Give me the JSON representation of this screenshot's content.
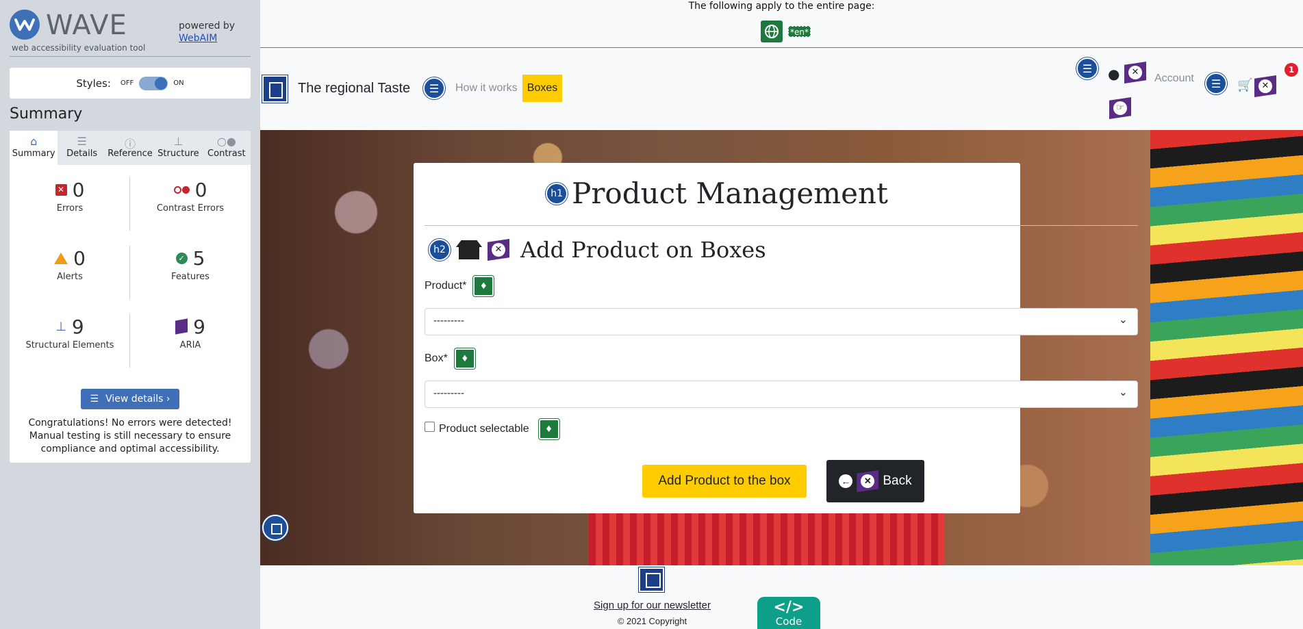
{
  "wave": {
    "title": "WAVE",
    "subtitle": "web accessibility evaluation tool",
    "powered_by": "powered by",
    "webaim_link": "WebAIM",
    "styles_label": "Styles:",
    "styles_off": "OFF",
    "styles_on": "ON",
    "summary_heading": "Summary",
    "tabs": [
      {
        "label": "Summary",
        "icon": "home-icon"
      },
      {
        "label": "Details",
        "icon": "list-icon"
      },
      {
        "label": "Reference",
        "icon": "info-icon"
      },
      {
        "label": "Structure",
        "icon": "hierarchy-icon"
      },
      {
        "label": "Contrast",
        "icon": "contrast-icon"
      }
    ],
    "stats": {
      "errors": {
        "value": "0",
        "label": "Errors"
      },
      "contrast_errors": {
        "value": "0",
        "label": "Contrast Errors"
      },
      "alerts": {
        "value": "0",
        "label": "Alerts"
      },
      "features": {
        "value": "5",
        "label": "Features"
      },
      "structural": {
        "value": "9",
        "label": "Structural Elements"
      },
      "aria": {
        "value": "9",
        "label": "ARIA"
      }
    },
    "view_details": "View details ›",
    "congrats": "Congratulations! No errors were detected! Manual testing is still necessary to ensure compliance and optimal accessibility."
  },
  "page": {
    "applies_text": "The following apply to the entire page:",
    "lang_badge": "*en*",
    "brand": "The regional Taste",
    "nav_how": "How it works",
    "nav_boxes": "Boxes",
    "account": "Account",
    "cart_count": "1",
    "h1_badge": "h1",
    "h2_badge": "h2",
    "title": "Product Management",
    "subtitle": "Add Product on Boxes",
    "product_label": "Product*",
    "product_value": "---------",
    "box_label": "Box*",
    "box_value": "---------",
    "selectable_label": "Product selectable",
    "add_button": "Add Product to the box",
    "back_button": "Back",
    "newsletter": "Sign up for our newsletter",
    "copyright": "© 2021 Copyright",
    "code_badge_tag": "</>",
    "code_badge_label": "Code"
  },
  "colors": {
    "wave_blue": "#3e6fb7",
    "accent_yellow": "#ffcc00",
    "error_red": "#c4262e",
    "feature_green": "#1e7a3c",
    "aria_purple": "#5b2c86",
    "dark": "#212529"
  }
}
